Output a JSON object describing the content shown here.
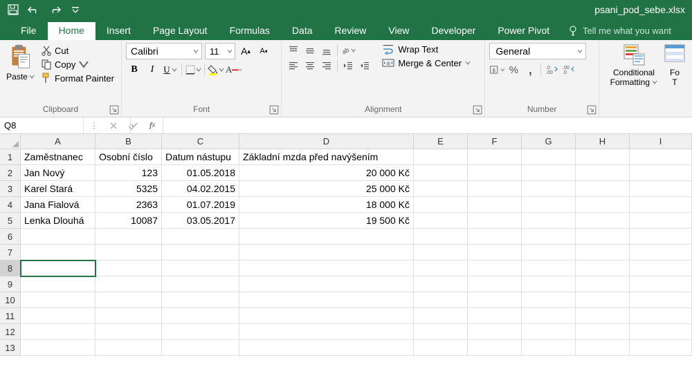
{
  "app_title": "psani_pod_sebe.xlsx",
  "tabs": {
    "file": "File",
    "home": "Home",
    "insert": "Insert",
    "page_layout": "Page Layout",
    "formulas": "Formulas",
    "data": "Data",
    "review": "Review",
    "view": "View",
    "developer": "Developer",
    "power_pivot": "Power Pivot",
    "tell_me": "Tell me what you want"
  },
  "ribbon": {
    "clipboard": {
      "paste": "Paste",
      "cut": "Cut",
      "copy": "Copy",
      "painter": "Format Painter",
      "label": "Clipboard"
    },
    "font": {
      "name": "Calibri",
      "size": "11",
      "label": "Font",
      "bold": "B",
      "italic": "I",
      "underline": "U"
    },
    "alignment": {
      "label": "Alignment",
      "wrap": "Wrap Text",
      "merge": "Merge & Center"
    },
    "number": {
      "format": "General",
      "label": "Number"
    },
    "styles": {
      "cond1": "Conditional",
      "cond2": "Formatting",
      "fmt1": "Fo",
      "fmt2": "T"
    }
  },
  "namebox": "Q8",
  "formula": "",
  "cols": [
    "A",
    "B",
    "C",
    "D",
    "E",
    "F",
    "G",
    "H",
    "I"
  ],
  "rows": [
    "1",
    "2",
    "3",
    "4",
    "5",
    "6",
    "7",
    "8",
    "9",
    "10",
    "11",
    "12",
    "13"
  ],
  "grid": {
    "header": [
      "Zaměstnanec",
      "Osobní číslo",
      "Datum nástupu",
      "Základní mzda před navýšením"
    ],
    "data": [
      [
        "Jan Nový",
        "123",
        "01.05.2018",
        "20 000 Kč"
      ],
      [
        "Karel Stará",
        "5325",
        "04.02.2015",
        "25 000 Kč"
      ],
      [
        "Jana Fialová",
        "2363",
        "01.07.2019",
        "18 000 Kč"
      ],
      [
        "Lenka Dlouhá",
        "10087",
        "03.05.2017",
        "19 500 Kč"
      ]
    ]
  },
  "active_row": 8
}
